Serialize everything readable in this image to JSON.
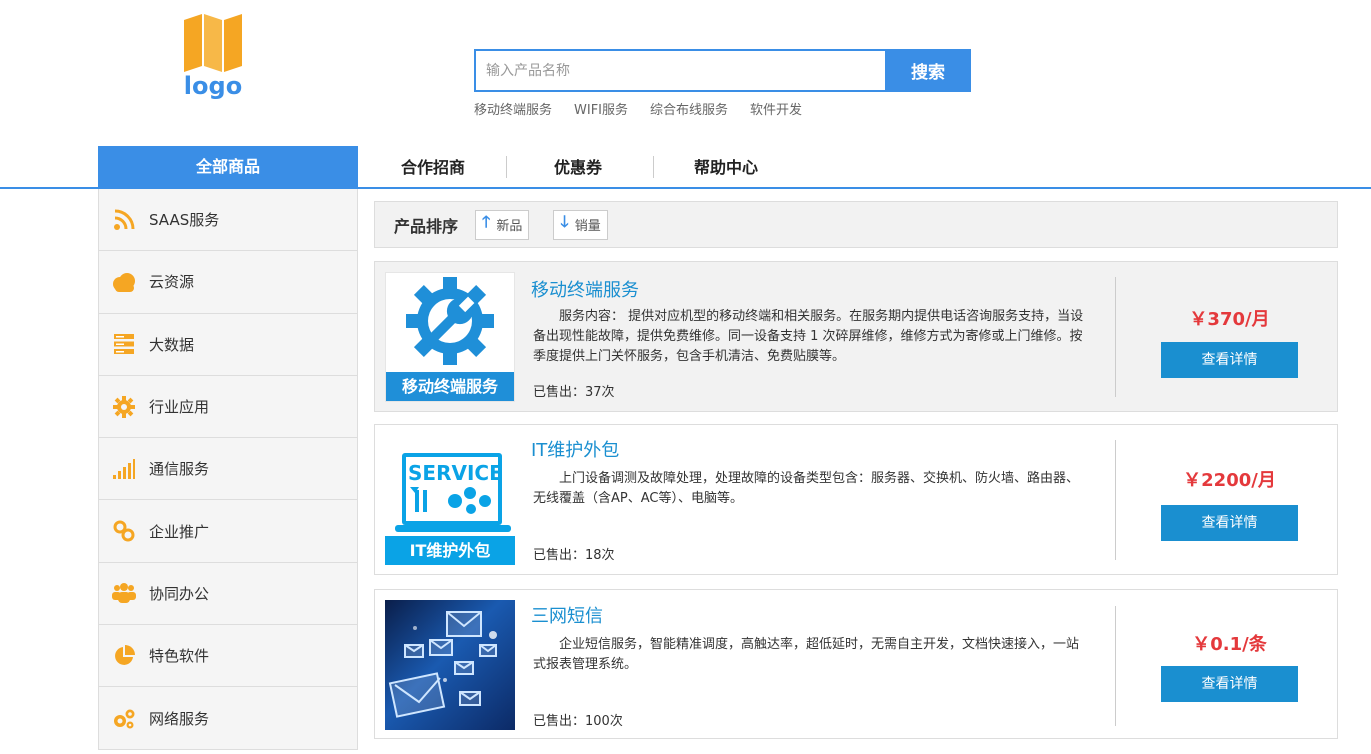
{
  "logo": {
    "text": "logo"
  },
  "search": {
    "placeholder": "输入产品名称",
    "button": "搜索"
  },
  "hotwords": [
    "移动终端服务",
    "WIFI服务",
    "综合布线服务",
    "软件开发"
  ],
  "nav": {
    "all": "全部商品",
    "items": [
      "合作招商",
      "优惠券",
      "帮助中心"
    ]
  },
  "sidebar": [
    {
      "icon": "rss-icon",
      "label": "SAAS服务"
    },
    {
      "icon": "cloud-icon",
      "label": "云资源"
    },
    {
      "icon": "server-icon",
      "label": "大数据"
    },
    {
      "icon": "gear-icon",
      "label": "行业应用"
    },
    {
      "icon": "signal-icon",
      "label": "通信服务"
    },
    {
      "icon": "link-icon",
      "label": "企业推广"
    },
    {
      "icon": "users-icon",
      "label": "协同办公"
    },
    {
      "icon": "pie-chart-icon",
      "label": "特色软件"
    },
    {
      "icon": "gears-icon",
      "label": "网络服务"
    }
  ],
  "sort": {
    "title": "产品排序",
    "new": "新品",
    "sales": "销量"
  },
  "products": [
    {
      "title": "移动终端服务",
      "thumb_caption": "移动终端服务",
      "desc": "服务内容： 提供对应机型的移动终端和相关服务。在服务期内提供电话咨询服务支持，当设备出现性能故障，提供免费维修。同一设备支持 1 次碎屏维修，维修方式为寄修或上门维修。按季度提供上门关怀服务，包含手机清洁、免费贴膜等。",
      "sold": "已售出：37次",
      "price": "￥370/月",
      "button": "查看详情"
    },
    {
      "title": "IT维护外包",
      "thumb_caption": "IT维护外包",
      "thumb_label": "SERVICE",
      "desc": "上门设备调测及故障处理，处理故障的设备类型包含：服务器、交换机、防火墙、路由器、无线覆盖（含AP、AC等）、电脑等。",
      "sold": "已售出：18次",
      "price": "￥2200/月",
      "button": "查看详情"
    },
    {
      "title": "三网短信",
      "desc": "企业短信服务，智能精准调度，高触达率，超低延时，无需自主开发，文档快速接入，一站式报表管理系统。",
      "sold": "已售出：100次",
      "price": "￥0.1/条",
      "button": "查看详情"
    }
  ]
}
